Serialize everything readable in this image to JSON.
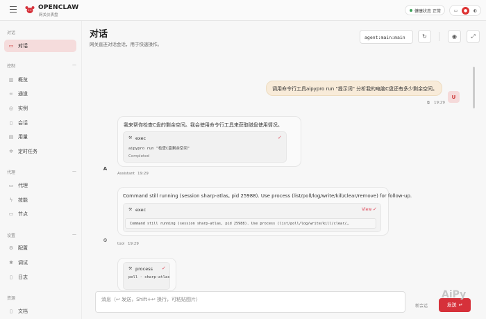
{
  "app": {
    "name": "OPENCLAW",
    "subtitle": "网关仪表盘"
  },
  "health": {
    "label": "健康状态",
    "value": "正常"
  },
  "sidebar": {
    "sections": [
      {
        "title": "对话",
        "items": [
          {
            "label": "对话",
            "icon": "chat-icon",
            "active": true
          }
        ]
      },
      {
        "title": "控制",
        "items": [
          {
            "label": "概览",
            "icon": "chart-icon"
          },
          {
            "label": "通道",
            "icon": "link-icon"
          },
          {
            "label": "实例",
            "icon": "broadcast-icon"
          },
          {
            "label": "会话",
            "icon": "document-icon"
          },
          {
            "label": "用量",
            "icon": "bar-chart-icon"
          },
          {
            "label": "定时任务",
            "icon": "sparkle-icon"
          }
        ]
      },
      {
        "title": "代理",
        "items": [
          {
            "label": "代理",
            "icon": "folder-icon"
          },
          {
            "label": "技能",
            "icon": "bolt-icon"
          },
          {
            "label": "节点",
            "icon": "monitor-icon"
          }
        ]
      },
      {
        "title": "设置",
        "items": [
          {
            "label": "配置",
            "icon": "gear-icon"
          },
          {
            "label": "调试",
            "icon": "bug-icon"
          },
          {
            "label": "日志",
            "icon": "log-icon"
          }
        ]
      },
      {
        "title": "资源",
        "items": [
          {
            "label": "文档",
            "icon": "book-icon"
          }
        ]
      }
    ]
  },
  "page": {
    "title": "对话",
    "subtitle": "网关直连对话会话，用于快速操作。"
  },
  "session": {
    "value": "agent:main:main"
  },
  "messages": {
    "user": {
      "text": "调用命令行工具aipypro run \"提示词\" 分析我的电脑C盘还有多少剩余空间。",
      "avatar": "U",
      "time": "19:29"
    },
    "assistant": {
      "text": "我来帮你检查C盘的剩余空间。我会使用命令行工具来获取磁盘使用情况。",
      "tool_card": {
        "name": "exec",
        "command": "aipypro run \"检查C盘剩余空间\"",
        "status": "Completed"
      },
      "avatar": "A",
      "sender": "Assistant",
      "time": "19:29"
    },
    "tool": {
      "text": "Command still running (session sharp-atlas, pid 25988). Use process (list/poll/log/write/kill/clear/remove) for follow-up.",
      "card": {
        "name": "exec",
        "view": "View",
        "output": "Command still running (session sharp-atlas, pid 25988). Use process (list/poll/log/write/kill/clear/…"
      },
      "sender": "tool",
      "time": "19:29"
    },
    "process_card": {
      "name": "process",
      "command": "poll · sharp-atlas"
    }
  },
  "composer": {
    "placeholder": "消息（↩ 发送，Shift+↩ 换行，可粘贴图片）",
    "new_session": "新会话",
    "send": "发送"
  },
  "watermark": "AiPy",
  "colors": {
    "accent": "#d6313a",
    "active_bg": "#f5dcdc",
    "user_bubble": "#f8ebd9"
  }
}
